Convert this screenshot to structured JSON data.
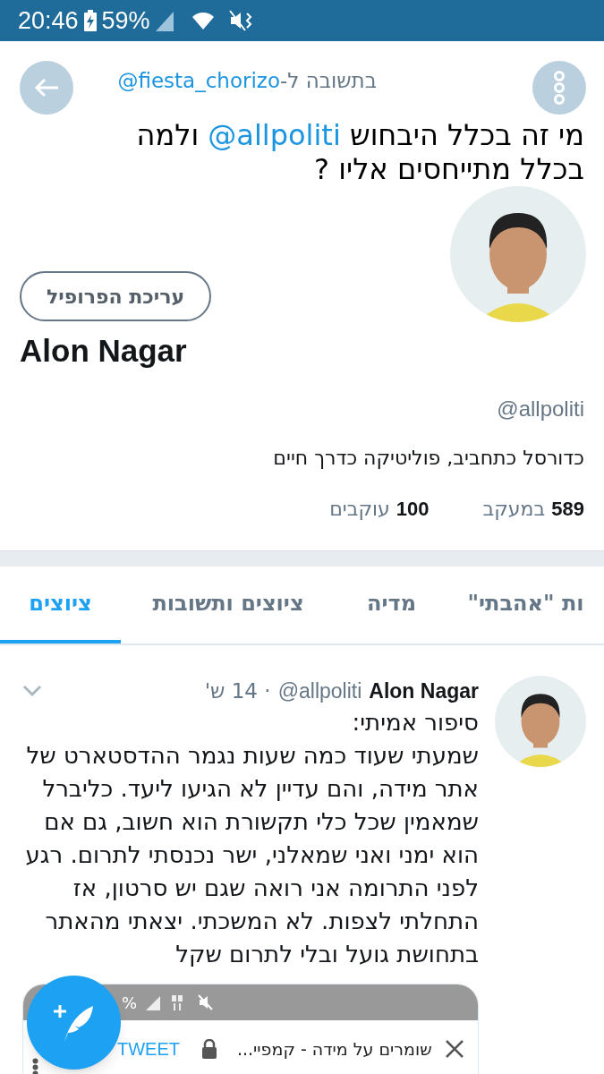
{
  "status_bar": {
    "time": "20:46",
    "battery": "59%"
  },
  "reply": {
    "prefix": "בתשובה ל-",
    "handle": "@fiesta_chorizo"
  },
  "headline": "מי זה בכלל היבחוש **@allpoliti** ולמה בכלל מתייחסים אליו ?",
  "profile": {
    "edit_button": "עריכת הפרופיל",
    "name": "Alon Nagar",
    "handle": "@allpoliti",
    "bio": "כדורסל כתחביב, פוליטיקה כדרך חיים",
    "stats": [
      {
        "count": "589",
        "label": "במעקב"
      },
      {
        "count": "100",
        "label": "עוקבים"
      }
    ]
  },
  "tabs": [
    {
      "label": "ות \"אהבתי\"",
      "selected": false
    },
    {
      "label": "מדיה",
      "selected": false
    },
    {
      "label": "ציוצים ותשובות",
      "selected": false
    },
    {
      "label": "ציוצים",
      "selected": true
    }
  ],
  "tweet": {
    "name": "Alon Nagar",
    "handle": "@allpoliti",
    "time": "· 14 ש'",
    "lines": [
      "סיפור אמיתי:",
      "שמעתי שעוד כמה שעות נגמר ההדסטארט של אתר מידה, והם עדיין לא הגיעו ליעד. כליברל שמאמין שכל כלי תקשורת הוא חשוב, גם אם הוא ימני ואני שמאלני, ישר נכנסתי לתרום. רגע לפני התרומה אני רואה שגם יש סרטון, אז התחלתי לצפות. לא המשכתי. יצאתי מהאתר בתחושת גועל ובלי לתרום שקל"
    ],
    "embed": {
      "status": "%",
      "title": "שומרים על מידה - קמפיי...",
      "action": "TWEET"
    }
  }
}
